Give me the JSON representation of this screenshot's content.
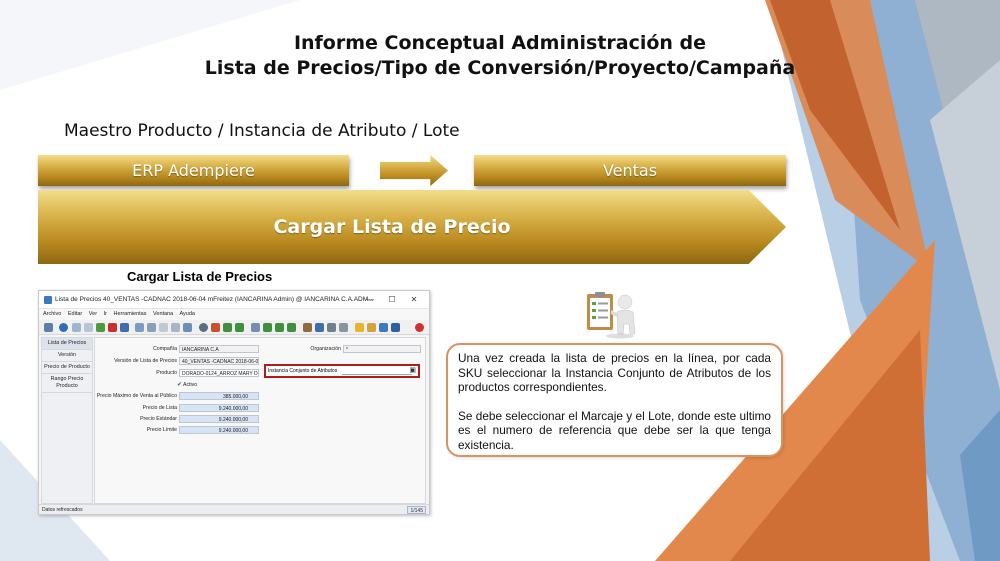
{
  "slide": {
    "title_line1": "Informe Conceptual Administración de",
    "title_line2": "Lista de Precios/Tipo de Conversión/Proyecto/Campaña",
    "subtitle": "Maestro Producto / Instancia de Atributo / Lote"
  },
  "flow": {
    "left_box": "ERP Adempiere",
    "right_box": "Ventas",
    "main_arrow": "Cargar Lista de Precio"
  },
  "screenshot_caption": "Cargar Lista de Precios",
  "app_window": {
    "title": "Lista de Precios  40_VENTAS -CADNAC 2018-06-04  mFreitez (IANCARINA Admin) @ IANCARINA C.A.ADM...",
    "controls": [
      "—",
      "☐",
      "✕"
    ],
    "menu": [
      "Archivo",
      "Editar",
      "Ver",
      "Ir",
      "Herramientas",
      "Ventana",
      "Ayuda"
    ],
    "tabs": [
      "Lista de Precios",
      "Versión",
      "Precio de Producto",
      "Rango Precio Producto"
    ],
    "fields": {
      "compania_label": "Compañía",
      "compania_value": "IANCARINA C.A",
      "organizacion_label": "Organización",
      "organizacion_value": "*",
      "version_label": "Versión de Lista de Precios",
      "version_value": "40_VENTAS -CADNAC 2018-06-04",
      "producto_label": "Producto",
      "producto_value": "DORADO-0124_ARROZ MARY DOI",
      "instancia_label": "Instancia Conjunto de Atributos",
      "instancia_value": "",
      "activo_label": "Activo",
      "pmvp_label": "Precio Máximo de Venta al Público",
      "pmvp_value": "385.000,00",
      "precio_lista_label": "Precio de Lista",
      "precio_lista_value": "9.240.000,00",
      "precio_estandar_label": "Precio Estándar",
      "precio_estandar_value": "9.240.000,00",
      "precio_limite_label": "Precio Límite",
      "precio_limite_value": "9.240.000,00"
    },
    "status_text": "Datos refrescados",
    "record_count": "1/145"
  },
  "info_box": {
    "paragraph1": "Una vez creada la lista de precios en la línea, por cada SKU seleccionar la Instancia Conjunto de Atributos de los productos correspondientes.",
    "paragraph2": "Se debe seleccionar el Marcaje y el Lote, donde este ultimo es el numero de referencia que debe ser la que tenga existencia."
  },
  "colors": {
    "gold": "#c99a2e",
    "orange_deco": "#d97a3e",
    "blue_deco": "#9bbad6",
    "info_border": "#d99362",
    "highlight_red": "#b01c1c"
  }
}
